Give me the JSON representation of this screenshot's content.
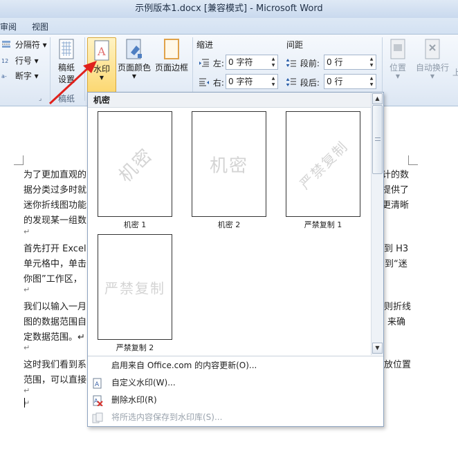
{
  "window": {
    "title": "示例版本1.docx [兼容模式]  -  Microsoft Word"
  },
  "tabs": {
    "review": "审阅",
    "view": "视图"
  },
  "ribbon": {
    "page_setup": {
      "separator": "分隔符",
      "line_numbers": "行号",
      "hyphenation": "断字"
    },
    "manuscript": {
      "button_label_1": "稿纸",
      "button_label_2": "设置",
      "group_label": "稿纸"
    },
    "page_background": {
      "watermark": "水印",
      "page_color": "页面颜色",
      "page_border": "页面边框"
    },
    "paragraph": {
      "indent_title": "缩进",
      "spacing_title": "间距",
      "indent_left_label": "左:",
      "indent_left_value": "0 字符",
      "indent_right_label": "右:",
      "indent_right_value": "0 字符",
      "spacing_before_label": "段前:",
      "spacing_before_value": "0 行",
      "spacing_after_label": "段后:",
      "spacing_after_value": "0 行"
    },
    "arrange": {
      "position": "位置",
      "wrap_text": "自动换行",
      "bring_forward_partial": "上"
    }
  },
  "watermark_gallery": {
    "section_title": "机密",
    "items": [
      {
        "label": "机密 1",
        "watermark_text": "机密",
        "style": "diagonal"
      },
      {
        "label": "机密 2",
        "watermark_text": "机密",
        "style": "horizontal"
      },
      {
        "label": "严禁复制 1",
        "watermark_text": "严禁复制",
        "style": "diagonal"
      },
      {
        "label": "严禁复制 2",
        "watermark_text": "严禁复制",
        "style": "horizontal"
      }
    ],
    "menu": {
      "update_from_office": "启用来自 Office.com 的内容更新(O)...",
      "custom_watermark": "自定义水印(W)...",
      "remove_watermark": "删除水印(R)",
      "save_selection": "将所选内容保存到水印库(S)..."
    }
  },
  "document": {
    "para1": {
      "line1_left": "为了更加直观的",
      "line1_right": "计的数",
      "line2_left": "据分类过多时就",
      "line2_right": "提供了",
      "line3_left": "迷你折线图功能",
      "line3_right": "更清晰",
      "line4_left": "的发现某一组数"
    },
    "para2": {
      "line1_left": "首先打开 Excel",
      "line1_right": "到 H3",
      "line2_left": "单元格中，单击",
      "line2_right": "到“迷",
      "line3_left": "你图”工作区，"
    },
    "para3": {
      "line1_left": "我们以输入一月",
      "line1_right": "则折线",
      "line2_left": "图的数据范围自",
      "line2_right": "来确",
      "line3_left": "定数据范围。↵"
    },
    "para4": {
      "line1_left": "这时我们看到系",
      "line1_right": "放位置",
      "line2_left": "范围，可以直接"
    },
    "paragraph_mark": "↵"
  },
  "colors": {
    "accent_arrow": "#e0211c",
    "selected_button": "#fde08a"
  }
}
